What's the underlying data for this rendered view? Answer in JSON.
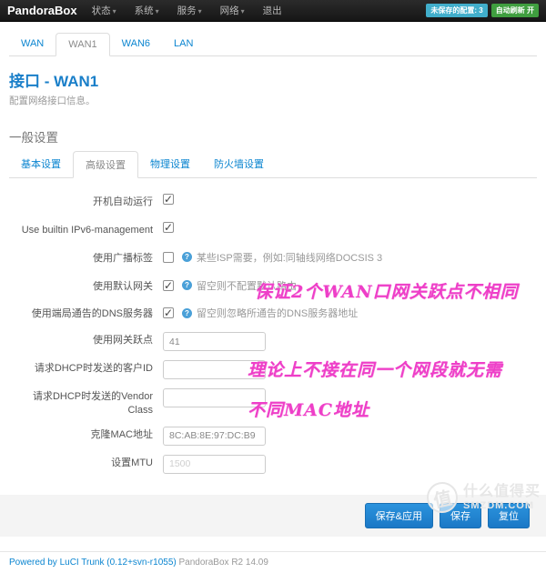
{
  "navbar": {
    "brand": "PandoraBox",
    "caret_char": "▾",
    "menus": [
      {
        "label": "状态"
      },
      {
        "label": "系统"
      },
      {
        "label": "服务"
      },
      {
        "label": "网络"
      },
      {
        "label": "退出"
      }
    ],
    "badges": [
      {
        "label": "未保存的配置: 3",
        "color": "#41aecb"
      },
      {
        "label": "自动刷新 开",
        "color": "#3f9e3f"
      }
    ]
  },
  "interface_tabs": [
    {
      "label": "WAN",
      "active": false
    },
    {
      "label": "WAN1",
      "active": true
    },
    {
      "label": "WAN6",
      "active": false
    },
    {
      "label": "LAN",
      "active": false
    }
  ],
  "page": {
    "title": "接口 - WAN1",
    "subtitle": "配置网络接口信息。",
    "section_legend": "一般设置"
  },
  "settings_tabs": [
    {
      "label": "基本设置",
      "active": false
    },
    {
      "label": "高级设置",
      "active": true
    },
    {
      "label": "物理设置",
      "active": false
    },
    {
      "label": "防火墙设置",
      "active": false
    }
  ],
  "form": {
    "rows": [
      {
        "label": "开机自动运行",
        "type": "checkbox",
        "checked": true,
        "description": ""
      },
      {
        "label": "Use builtin IPv6-management",
        "type": "checkbox",
        "checked": true,
        "description": ""
      },
      {
        "label": "使用广播标签",
        "type": "checkbox",
        "checked": false,
        "description": "某些ISP需要，例如:同轴线网络DOCSIS 3"
      },
      {
        "label": "使用默认网关",
        "type": "checkbox",
        "checked": true,
        "description": "留空则不配置默认路由"
      },
      {
        "label": "使用端局通告的DNS服务器",
        "type": "checkbox",
        "checked": true,
        "description": "留空则忽略所通告的DNS服务器地址"
      },
      {
        "label": "使用网关跃点",
        "type": "text",
        "value": "41",
        "placeholder": ""
      },
      {
        "label": "请求DHCP时发送的客户ID",
        "type": "text",
        "value": "",
        "placeholder": ""
      },
      {
        "label": "请求DHCP时发送的Vendor Class",
        "type": "text",
        "value": "",
        "placeholder": ""
      },
      {
        "label": "克隆MAC地址",
        "type": "text",
        "value": "8C:AB:8E:97:DC:B9",
        "placeholder": ""
      },
      {
        "label": "设置MTU",
        "type": "text",
        "value": "",
        "placeholder": "1500"
      }
    ]
  },
  "annotations": {
    "note1": "保证2个WAN口网关跃点不相同",
    "note2": "理论上不接在同一个网段就无需",
    "note3": "不同MAC地址",
    "color": "#ee3fc8"
  },
  "buttons": {
    "save_apply": "保存&应用",
    "save": "保存",
    "reset": "复位"
  },
  "footer": {
    "link": "Powered by LuCI Trunk (0.12+svn-r1055)",
    "text": " PandoraBox R2 14.09"
  },
  "watermark": {
    "logo_char": "值",
    "line1": "什么值得买",
    "line2": "SMZDM.COM"
  },
  "colors": {
    "navbar_bg": "#1c1c1c",
    "link_blue": "#0b85d0",
    "title_blue": "#1a7fc9",
    "button_blue": "#1f87d7",
    "annotation_pink": "#ee3fc8",
    "badge_teal": "#41aecb",
    "badge_green": "#3f9e3f"
  }
}
